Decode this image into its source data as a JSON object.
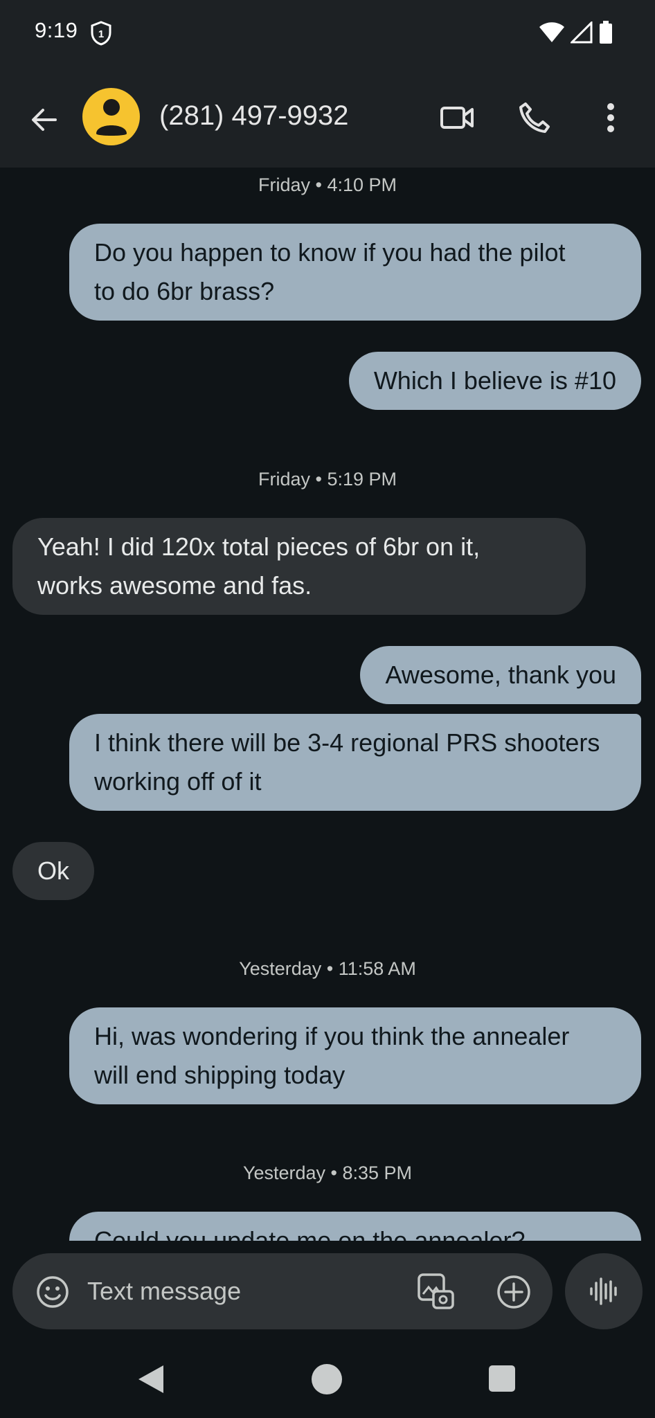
{
  "status_bar": {
    "time": "9:19",
    "shield_badge": "1"
  },
  "header": {
    "contact": "(281) 497-9932",
    "icons": {
      "back": "arrow-back-icon",
      "avatar": "person-icon",
      "video": "video-call-icon",
      "call": "phone-icon",
      "more": "more-vert-icon"
    },
    "avatar_color": "#f6c32f"
  },
  "thread": {
    "timestamps": [
      "Friday • 4:10 PM",
      "Friday • 5:19 PM",
      "Yesterday • 11:58 AM",
      "Yesterday • 8:35 PM"
    ],
    "messages": [
      {
        "direction": "outgoing",
        "lines": [
          "Do you happen to know if you had the pilot",
          "to do 6br brass?"
        ]
      },
      {
        "direction": "outgoing",
        "lines": [
          "Which I believe is #10"
        ]
      },
      {
        "direction": "incoming",
        "lines": [
          "Yeah! I did 120x total pieces of 6br on it,",
          "works awesome and fas."
        ]
      },
      {
        "direction": "outgoing",
        "lines": [
          "Awesome, thank you"
        ]
      },
      {
        "direction": "outgoing",
        "lines": [
          "I think there will be 3-4 regional PRS shooters",
          "working off of it"
        ]
      },
      {
        "direction": "incoming",
        "lines": [
          "Ok"
        ]
      },
      {
        "direction": "outgoing",
        "lines": [
          "Hi, was wondering if you think the annealer",
          "will end shipping today"
        ]
      },
      {
        "direction": "outgoing",
        "lines": [
          "Could you update me on the annealer?"
        ]
      }
    ],
    "colors": {
      "outgoing_bubble": "#9eb0be",
      "incoming_bubble": "#2e3235"
    }
  },
  "composer": {
    "placeholder": "Text message",
    "icons": {
      "emoji": "emoji-icon",
      "gallery": "gallery-icon",
      "add": "add-circle-icon",
      "voice": "voice-waveform-icon"
    }
  },
  "nav": {
    "icons": [
      "nav-back-icon",
      "nav-home-icon",
      "nav-recents-icon"
    ]
  }
}
